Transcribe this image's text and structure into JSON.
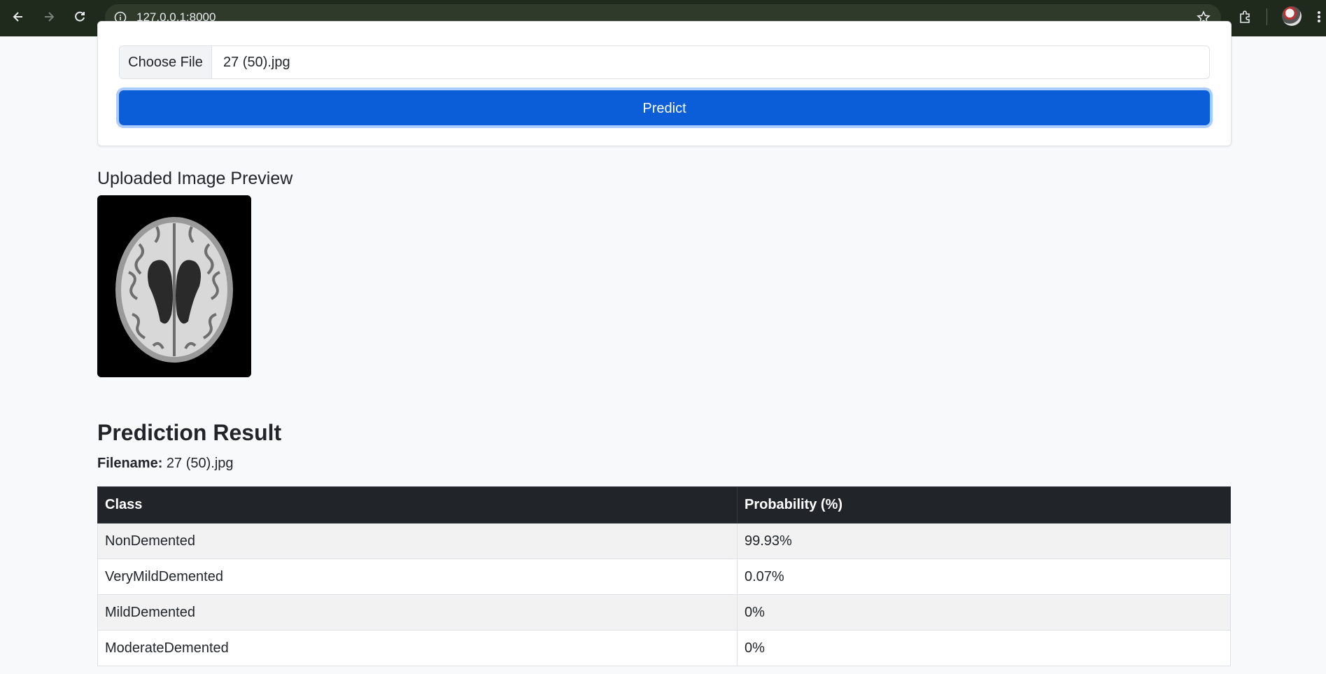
{
  "browser": {
    "url": "127.0.0.1:8000"
  },
  "upload": {
    "choose_file_label": "Choose File",
    "file_name": "27 (50).jpg",
    "predict_label": "Predict"
  },
  "preview": {
    "title": "Uploaded Image Preview"
  },
  "result": {
    "title": "Prediction Result",
    "filename_label": "Filename:",
    "filename_value": "27 (50).jpg",
    "columns": [
      "Class",
      "Probability (%)"
    ],
    "rows": [
      {
        "class": "NonDemented",
        "probability": "99.93%"
      },
      {
        "class": "VeryMildDemented",
        "probability": "0.07%"
      },
      {
        "class": "MildDemented",
        "probability": "0%"
      },
      {
        "class": "ModerateDemented",
        "probability": "0%"
      }
    ]
  }
}
